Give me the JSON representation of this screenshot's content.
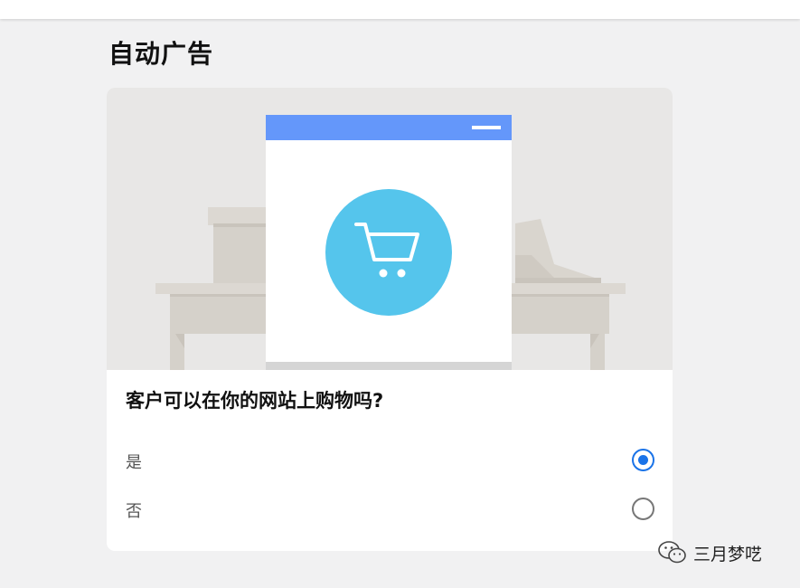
{
  "page": {
    "title": "自动广告"
  },
  "card": {
    "question": "客户可以在你的网站上购物吗?",
    "options": [
      {
        "label": "是",
        "selected": true
      },
      {
        "label": "否",
        "selected": false
      }
    ]
  },
  "illustration": {
    "icon": "shopping-cart-icon"
  },
  "watermark": {
    "text": "三月梦呓",
    "icon": "wechat-icon"
  },
  "colors": {
    "accent": "#1a73e8",
    "window_header": "#6497fa",
    "cart_circle": "#55c5ec",
    "background": "#f1f1f2"
  }
}
